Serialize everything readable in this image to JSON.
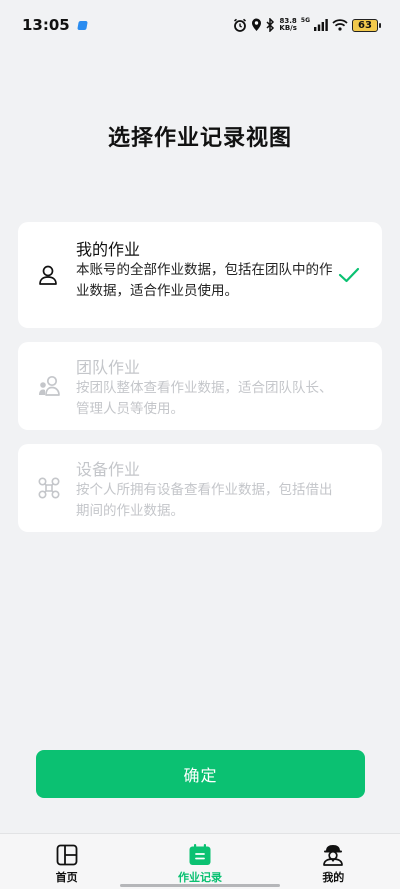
{
  "status_bar": {
    "time": "13:05",
    "net_speed_value": "83.8",
    "net_speed_unit": "KB/s",
    "network_type": "5G",
    "battery": "63"
  },
  "page": {
    "title": "选择作业记录视图"
  },
  "options": [
    {
      "title": "我的作业",
      "description": "本账号的全部作业数据，包括在团队中的作业数据，适合作业员使用。",
      "icon": "person-icon",
      "selected": true,
      "enabled": true
    },
    {
      "title": "团队作业",
      "description": "按团队整体查看作业数据，适合团队队长、管理人员等使用。",
      "icon": "team-icon",
      "selected": false,
      "enabled": false
    },
    {
      "title": "设备作业",
      "description": "按个人所拥有设备查看作业数据，包括借出期间的作业数据。",
      "icon": "drone-icon",
      "selected": false,
      "enabled": false
    }
  ],
  "confirm_button": {
    "label": "确定"
  },
  "tab_bar": {
    "tabs": [
      {
        "label": "首页",
        "icon": "home-grid-icon",
        "active": false
      },
      {
        "label": "作业记录",
        "icon": "calendar-record-icon",
        "active": true
      },
      {
        "label": "我的",
        "icon": "profile-pilot-icon",
        "active": false
      }
    ]
  },
  "colors": {
    "accent": "#0bc172",
    "background": "#f1f2f4",
    "card": "#ffffff",
    "disabled_text": "#c4c6ca"
  }
}
